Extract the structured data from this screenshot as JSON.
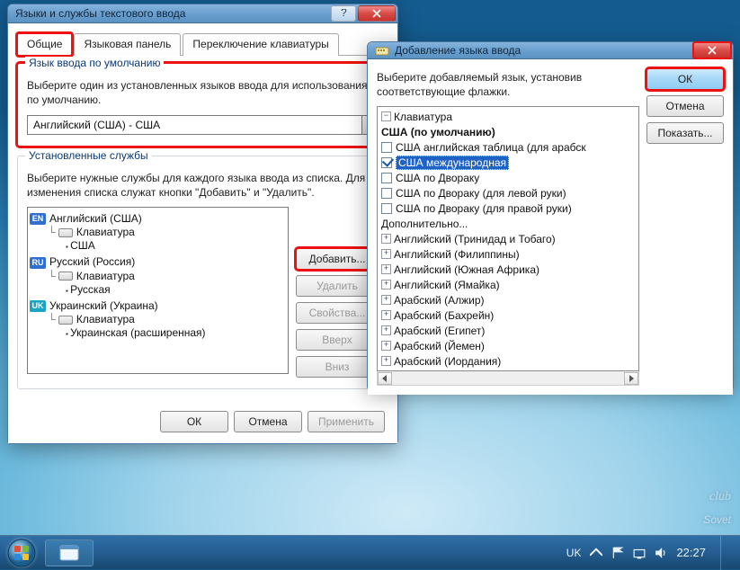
{
  "dlg1": {
    "title": "Языки и службы текстового ввода",
    "tabs": [
      "Общие",
      "Языковая панель",
      "Переключение клавиатуры"
    ],
    "group_default": {
      "legend": "Язык ввода по умолчанию",
      "desc": "Выберите один из установленных языков ввода для использования по умолчанию.",
      "combo_value": "Английский (США) - США"
    },
    "group_installed": {
      "legend": "Установленные службы",
      "desc": "Выберите нужные службы для каждого языка ввода из списка. Для изменения списка служат кнопки \"Добавить\" и \"Удалить\".",
      "languages": [
        {
          "code": "EN",
          "color": "#2f6fd0",
          "name": "Английский (США)",
          "kb_label": "Клавиатура",
          "layouts": [
            "США"
          ]
        },
        {
          "code": "RU",
          "color": "#2f6fd0",
          "name": "Русский (Россия)",
          "kb_label": "Клавиатура",
          "layouts": [
            "Русская"
          ]
        },
        {
          "code": "UK",
          "color": "#1aa4c8",
          "name": "Украинский (Украина)",
          "kb_label": "Клавиатура",
          "layouts": [
            "Украинская (расширенная)"
          ]
        }
      ],
      "buttons": {
        "add": "Добавить...",
        "remove": "Удалить",
        "props": "Свойства...",
        "up": "Вверх",
        "down": "Вниз"
      }
    },
    "footer": {
      "ok": "ОК",
      "cancel": "Отмена",
      "apply": "Применить"
    }
  },
  "dlg2": {
    "title": "Добавление языка ввода",
    "desc": "Выберите добавляемый язык, установив соответствующие флажки.",
    "buttons": {
      "ok": "ОК",
      "cancel": "Отмена",
      "preview": "Показать..."
    },
    "tree_root": "Клавиатура",
    "default_label": "США (по умолчанию)",
    "kb_options": [
      {
        "label": "США английская таблица (для арабск",
        "checked": false
      },
      {
        "label": "США международная",
        "checked": true,
        "selected": true
      },
      {
        "label": "США по Двораку",
        "checked": false
      },
      {
        "label": "США по Двораку (для левой руки)",
        "checked": false
      },
      {
        "label": "США по Двораку (для правой руки)",
        "checked": false
      }
    ],
    "more_label": "Дополнительно...",
    "languages": [
      "Английский (Тринидад и Тобаго)",
      "Английский (Филиппины)",
      "Английский (Южная Африка)",
      "Английский (Ямайка)",
      "Арабский (Алжир)",
      "Арабский (Бахрейн)",
      "Арабский (Египет)",
      "Арабский (Йемен)",
      "Арабский (Иордания)"
    ]
  },
  "taskbar": {
    "lang": "UK",
    "time": "22:27"
  },
  "watermark": {
    "top": "club",
    "bottom": "Sovet"
  }
}
